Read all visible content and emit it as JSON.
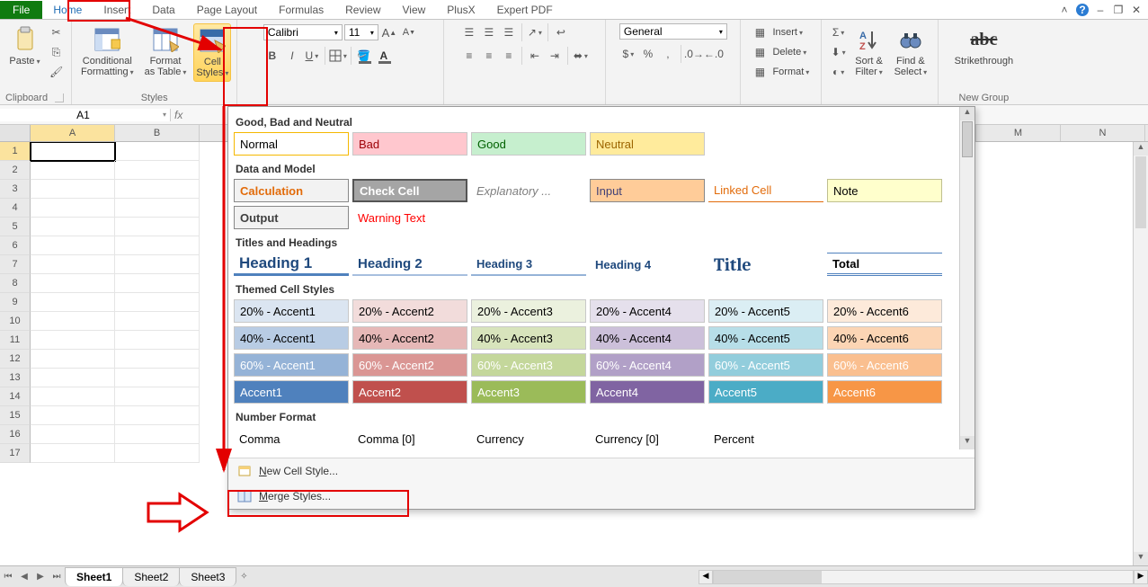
{
  "tabs": {
    "file": "File",
    "home": "Home",
    "insert": "Insert",
    "data": "Data",
    "pagelayout": "Page Layout",
    "formulas": "Formulas",
    "review": "Review",
    "view": "View",
    "plusx": "PlusX",
    "expertpdf": "Expert PDF"
  },
  "groups": {
    "clipboard": {
      "label": "Clipboard",
      "paste": "Paste"
    },
    "styles": {
      "label": "Styles",
      "conditional": "Conditional\nFormatting",
      "formatTable": "Format\nas Table",
      "cellStyles": "Cell\nStyles"
    },
    "font": {
      "name": "Calibri",
      "size": "11"
    },
    "number": {
      "fmt": "General"
    },
    "cells": {
      "insert": "Insert",
      "delete": "Delete",
      "format": "Format"
    },
    "editing": {
      "sortfilter": "Sort &\nFilter",
      "findselect": "Find &\nSelect"
    },
    "newgroup": {
      "label": "New Group",
      "strike": "Strikethrough"
    }
  },
  "namebox": "A1",
  "columns_left": [
    "A",
    "B"
  ],
  "columns_right": [
    "M",
    "N"
  ],
  "rows": [
    "1",
    "2",
    "3",
    "4",
    "5",
    "6",
    "7",
    "8",
    "9",
    "10",
    "11",
    "12",
    "13",
    "14",
    "15",
    "16",
    "17"
  ],
  "sheets": {
    "s1": "Sheet1",
    "s2": "Sheet2",
    "s3": "Sheet3"
  },
  "gallery": {
    "sec1": "Good, Bad and Neutral",
    "normal": "Normal",
    "bad": "Bad",
    "good": "Good",
    "neutral": "Neutral",
    "sec2": "Data and Model",
    "calculation": "Calculation",
    "checkcell": "Check Cell",
    "explanatory": "Explanatory ...",
    "input": "Input",
    "linkedcell": "Linked Cell",
    "note": "Note",
    "output": "Output",
    "warning": "Warning Text",
    "sec3": "Titles and Headings",
    "h1": "Heading 1",
    "h2": "Heading 2",
    "h3": "Heading 3",
    "h4": "Heading 4",
    "title": "Title",
    "total": "Total",
    "sec4": "Themed Cell Styles",
    "a20_1": "20% - Accent1",
    "a20_2": "20% - Accent2",
    "a20_3": "20% - Accent3",
    "a20_4": "20% - Accent4",
    "a20_5": "20% - Accent5",
    "a20_6": "20% - Accent6",
    "a40_1": "40% - Accent1",
    "a40_2": "40% - Accent2",
    "a40_3": "40% - Accent3",
    "a40_4": "40% - Accent4",
    "a40_5": "40% - Accent5",
    "a40_6": "40% - Accent6",
    "a60_1": "60% - Accent1",
    "a60_2": "60% - Accent2",
    "a60_3": "60% - Accent3",
    "a60_4": "60% - Accent4",
    "a60_5": "60% - Accent5",
    "a60_6": "60% - Accent6",
    "acc1": "Accent1",
    "acc2": "Accent2",
    "acc3": "Accent3",
    "acc4": "Accent4",
    "acc5": "Accent5",
    "acc6": "Accent6",
    "sec5": "Number Format",
    "comma": "Comma",
    "comma0": "Comma [0]",
    "currency": "Currency",
    "currency0": "Currency [0]",
    "percent": "Percent",
    "newcell": "New Cell Style...",
    "merge": "Merge Styles..."
  },
  "colors": {
    "accent1": "#4f81bd",
    "accent2": "#c0504d",
    "accent3": "#9bbb59",
    "accent4": "#8064a2",
    "accent5": "#4bacc6",
    "accent6": "#f79646",
    "goodFill": "#c6efce",
    "goodText": "#228b22",
    "badFill": "#ffc7ce",
    "badText": "#9c0006",
    "neutralFill": "#ffeb9c",
    "neutralText": "#9c6500",
    "calcText": "#e26b0a",
    "checkFill": "#a5a5a5",
    "inputFill": "#ffcc99",
    "linkedText": "#e26b0a",
    "noteFill": "#ffffcc",
    "warnText": "#ff0000",
    "titleText": "#1f497d"
  }
}
